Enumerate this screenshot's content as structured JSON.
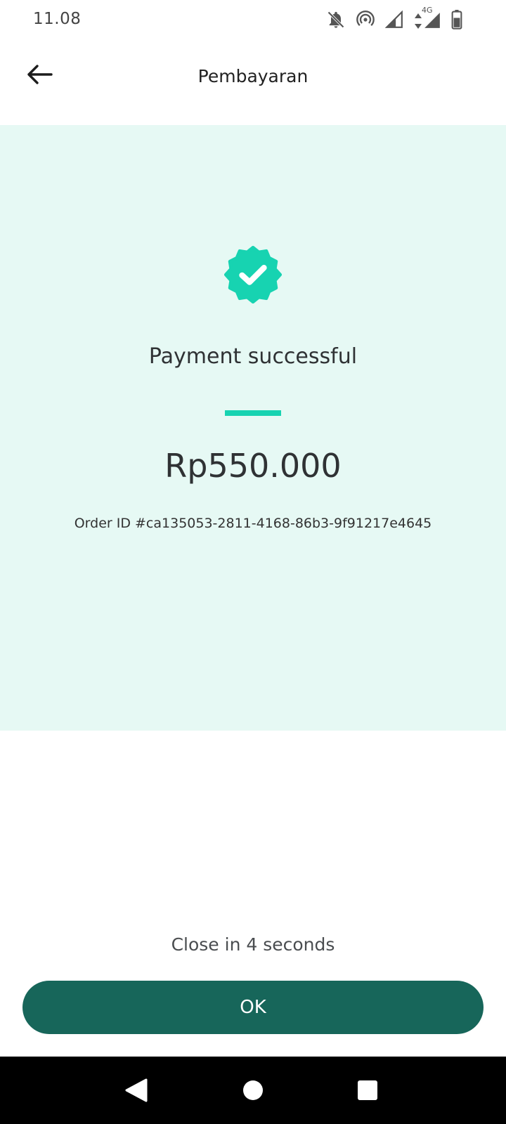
{
  "status_bar": {
    "time": "11.08",
    "icons": [
      "bell-off-icon",
      "hotspot-icon",
      "signal-icon",
      "signal-4g-icon",
      "battery-icon"
    ],
    "network_label": "4G"
  },
  "app_bar": {
    "title": "Pembayaran",
    "back_icon": "arrow-left-icon"
  },
  "payment": {
    "status_icon": "verified-check-icon",
    "title": "Payment successful",
    "amount": "Rp550.000",
    "order_id": "Order ID #ca135053-2811-4168-86b3-9f91217e4645"
  },
  "footer": {
    "countdown": "Close in 4 seconds",
    "ok_label": "OK"
  },
  "nav_bar": {
    "icons": [
      "nav-back-icon",
      "nav-home-icon",
      "nav-recents-icon"
    ]
  },
  "colors": {
    "panel_background": "#e6f9f4",
    "accent": "#17d3b1",
    "button": "#17665a"
  }
}
